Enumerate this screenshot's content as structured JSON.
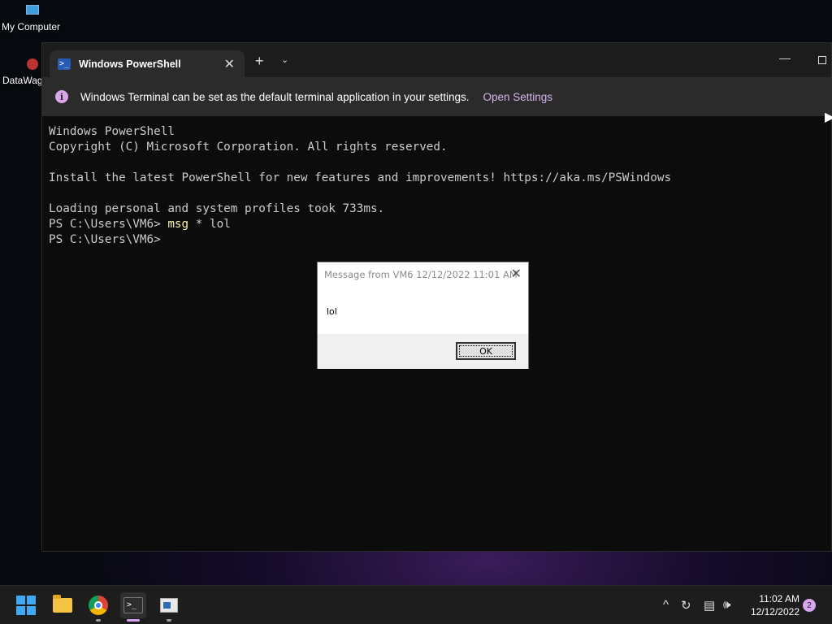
{
  "desktop": {
    "icons": [
      {
        "label": "My Computer",
        "icon": "monitor-icon"
      },
      {
        "label": "DataWag",
        "icon": "app-shortcut-icon"
      }
    ]
  },
  "terminal": {
    "tab": {
      "title": "Windows PowerShell",
      "icon": "powershell-icon",
      "close": "✕"
    },
    "new_tab": "+",
    "dropdown": "⌄",
    "infobar": {
      "message": "Windows Terminal can be set as the default terminal application in your settings.",
      "link": "Open Settings"
    },
    "lines": [
      "Windows PowerShell",
      "Copyright (C) Microsoft Corporation. All rights reserved.",
      "",
      "Install the latest PowerShell for new features and improvements! https://aka.ms/PSWindows",
      "",
      "Loading personal and system profiles took 733ms."
    ],
    "prompt1": "PS C:\\Users\\VM6> ",
    "command1_name": "msg",
    "command1_args": " * lol",
    "prompt2": "PS C:\\Users\\VM6>"
  },
  "dialog": {
    "title": "Message from VM6 12/12/2022 11:01 AM",
    "close": "✕",
    "message": "lol",
    "ok_label": "OK"
  },
  "taskbar": {
    "apps": [
      "start-icon",
      "file-explorer-icon",
      "chrome-icon",
      "terminal-icon",
      "news-app-icon"
    ],
    "tray": {
      "chevron": "^",
      "volume": "🕪"
    },
    "time": "11:02 AM",
    "date": "12/12/2022",
    "notification_count": "2"
  },
  "colors": {
    "accent": "#d7b4f0",
    "terminal_bg": "#0c0c0c",
    "command_yellow": "#f9f1a5"
  }
}
